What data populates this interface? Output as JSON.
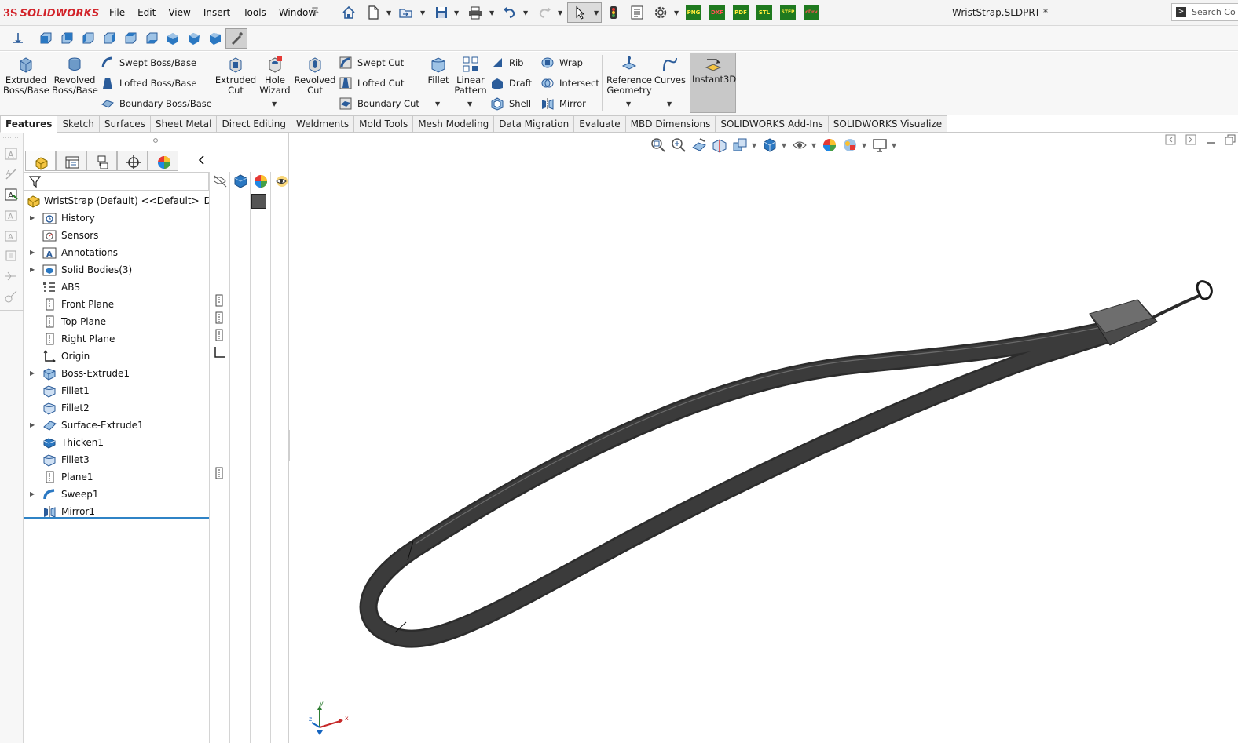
{
  "app": {
    "logo_ds": "3S",
    "logo_name": "SOLIDWORKS",
    "document_title": "WristStrap.SLDPRT *",
    "search_placeholder": "Search Co"
  },
  "menu": [
    "File",
    "Edit",
    "View",
    "Insert",
    "Tools",
    "Window"
  ],
  "quick_access": [
    "home-icon",
    "new-icon",
    "open-icon",
    "save-icon",
    "print-icon",
    "undo-icon",
    "redo-icon",
    "select-icon",
    "rebuild-icon",
    "file-properties-icon",
    "options-icon"
  ],
  "export_macros": [
    "PNG",
    "DXF",
    "PDF",
    "STL",
    "STEP",
    "cDrv"
  ],
  "command_manager": {
    "extruded_boss": "Extruded Boss/Base",
    "revolved_boss": "Revolved Boss/Base",
    "swept_boss": "Swept Boss/Base",
    "lofted_boss": "Lofted Boss/Base",
    "boundary_boss": "Boundary Boss/Base",
    "extruded_cut": "Extruded Cut",
    "hole_wizard": "Hole Wizard",
    "revolved_cut": "Revolved Cut",
    "swept_cut": "Swept Cut",
    "lofted_cut": "Lofted Cut",
    "boundary_cut": "Boundary Cut",
    "fillet": "Fillet",
    "linear_pattern": "Linear Pattern",
    "rib": "Rib",
    "draft": "Draft",
    "shell": "Shell",
    "wrap": "Wrap",
    "intersect": "Intersect",
    "mirror": "Mirror",
    "reference_geometry": "Reference Geometry",
    "curves": "Curves",
    "instant3d": "Instant3D"
  },
  "tabs": [
    "Features",
    "Sketch",
    "Surfaces",
    "Sheet Metal",
    "Direct Editing",
    "Weldments",
    "Mold Tools",
    "Mesh Modeling",
    "Data Migration",
    "Evaluate",
    "MBD Dimensions",
    "SOLIDWORKS Add-Ins",
    "SOLIDWORKS Visualize"
  ],
  "active_tab": "Features",
  "feature_tree": {
    "root": "WristStrap (Default) <<Default>_Display",
    "items": [
      {
        "label": "History",
        "expandable": true,
        "icon": "history-folder-icon"
      },
      {
        "label": "Sensors",
        "expandable": false,
        "icon": "sensors-folder-icon"
      },
      {
        "label": "Annotations",
        "expandable": true,
        "icon": "annotations-folder-icon"
      },
      {
        "label": "Solid Bodies(3)",
        "expandable": true,
        "icon": "solid-bodies-folder-icon"
      },
      {
        "label": "ABS",
        "expandable": false,
        "icon": "material-icon"
      },
      {
        "label": "Front Plane",
        "expandable": false,
        "icon": "plane-icon"
      },
      {
        "label": "Top Plane",
        "expandable": false,
        "icon": "plane-icon"
      },
      {
        "label": "Right Plane",
        "expandable": false,
        "icon": "plane-icon"
      },
      {
        "label": "Origin",
        "expandable": false,
        "icon": "origin-icon"
      },
      {
        "label": "Boss-Extrude1",
        "expandable": true,
        "icon": "boss-extrude-icon"
      },
      {
        "label": "Fillet1",
        "expandable": false,
        "icon": "fillet-icon"
      },
      {
        "label": "Fillet2",
        "expandable": false,
        "icon": "fillet-icon"
      },
      {
        "label": "Surface-Extrude1",
        "expandable": true,
        "icon": "surface-extrude-icon"
      },
      {
        "label": "Thicken1",
        "expandable": false,
        "icon": "thicken-icon"
      },
      {
        "label": "Fillet3",
        "expandable": false,
        "icon": "fillet-icon"
      },
      {
        "label": "Plane1",
        "expandable": false,
        "icon": "plane-icon"
      },
      {
        "label": "Sweep1",
        "expandable": true,
        "icon": "sweep-icon"
      },
      {
        "label": "Mirror1",
        "expandable": false,
        "icon": "mirror-icon"
      }
    ]
  },
  "triad": {
    "x": "x",
    "y": "y",
    "z": "z"
  }
}
